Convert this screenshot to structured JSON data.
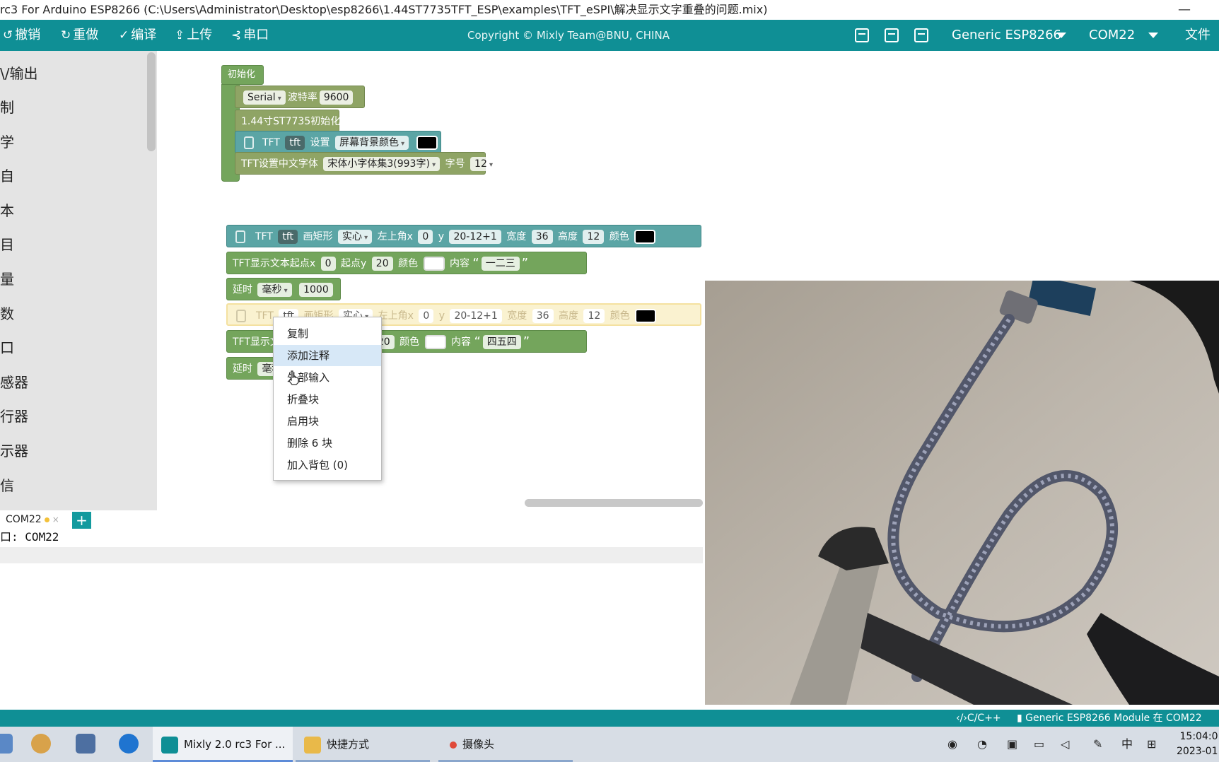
{
  "window": {
    "title": "rc3 For Arduino ESP8266 (C:\\Users\\Administrator\\Desktop\\esp8266\\1.44ST7735TFT_ESP\\examples\\TFT_eSPI\\解决显示文字重叠的问题.mix)",
    "minimize": "—"
  },
  "toolbar": {
    "undo": "撤销",
    "redo": "重做",
    "compile": "编译",
    "upload": "上传",
    "serial": "串口",
    "copyright": "Copyright © Mixly Team@BNU, CHINA",
    "board": "Generic ESP8266",
    "port": "COM22",
    "file_menu": "文件"
  },
  "sidebar": {
    "items": [
      "\\/输出",
      "制",
      "学",
      "自",
      "本",
      "目",
      "量",
      "数",
      "口",
      "感器",
      "行器",
      "示器",
      "信"
    ]
  },
  "blocks": {
    "init_hat": "初始化",
    "serial": {
      "name": "Serial",
      "baud_label": "波特率",
      "baud": "9600"
    },
    "st7735_init": "1.44寸ST7735初始化",
    "set_bg": {
      "tft": "TFT",
      "obj": "tft",
      "set": "设置",
      "prop": "屏幕背景颜色"
    },
    "font": {
      "label": "TFT设置中文字体",
      "font": "宋体小字体集3(993字)",
      "size_label": "字号",
      "size": "12"
    },
    "rect1": {
      "tft": "TFT",
      "obj": "tft",
      "draw": "画矩形",
      "mode": "实心",
      "x_label": "左上角x",
      "x": "0",
      "y_label": "y",
      "y": "20-12+1",
      "w_label": "宽度",
      "w": "36",
      "h_label": "高度",
      "h": "12",
      "color_label": "颜色"
    },
    "text1": {
      "label": "TFT显示文本起点x",
      "x": "0",
      "y_label": "起点y",
      "y": "20",
      "color_label": "颜色",
      "content_label": "内容",
      "content": "一二三"
    },
    "delay1": {
      "label": "延时",
      "unit": "毫秒",
      "ms": "1000"
    },
    "rect2": {
      "tft": "TFT",
      "obj": "tft",
      "draw": "画矩形",
      "mode": "实心",
      "x_label": "左上角x",
      "x": "0",
      "y_label": "y",
      "y": "20-12+1",
      "w_label": "宽度",
      "w": "36",
      "h_label": "高度",
      "h": "12",
      "color_label": "颜色"
    },
    "text2": {
      "label": "TFT显示文",
      "y": "20",
      "color_label": "颜色",
      "content_label": "内容",
      "content": "四五四"
    },
    "delay2": {
      "label": "延时",
      "unit": "毫秒"
    }
  },
  "context_menu": {
    "items": [
      "复制",
      "添加注释",
      "外部输入",
      "折叠块",
      "启用块",
      "删除 6 块",
      "加入背包 (0)"
    ],
    "hovered_index": 1
  },
  "bottom": {
    "tab": "COM22",
    "tab_close": "×",
    "add": "+",
    "console": "口: COM22"
  },
  "statusbar": {
    "lang": "C/C++",
    "board": "Generic ESP8266 Module 在 COM22"
  },
  "taskbar": {
    "apps": [
      "Mixly 2.0 rc3 For ...",
      "快捷方式",
      "摄像头"
    ],
    "ime": "中",
    "time": "15:04:0",
    "date": "2023-01"
  },
  "colors": {
    "accent": "#0f8f95",
    "block_teal": "#5ba5a5",
    "block_olive": "#8fa465",
    "block_green": "#74a55c"
  }
}
